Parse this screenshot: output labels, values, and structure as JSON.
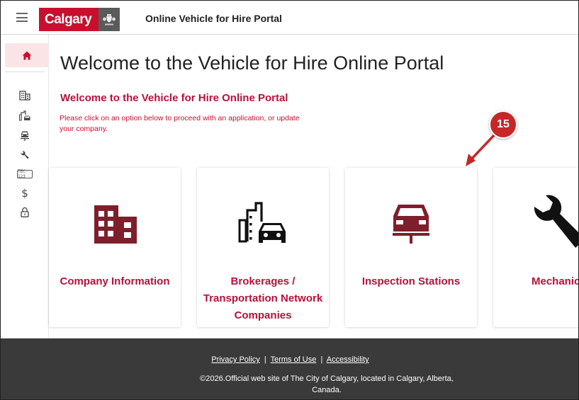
{
  "header": {
    "brand_text": "Calgary",
    "app_title": "Online Vehicle for Hire Portal"
  },
  "sidenav": {
    "items": [
      {
        "icon": "home-icon"
      },
      {
        "icon": "building-icon"
      },
      {
        "icon": "brokerage-car-icon"
      },
      {
        "icon": "inspection-car-icon"
      },
      {
        "icon": "wrench-icon"
      },
      {
        "icon": "license-plate-icon",
        "plate_text": "TEC-123"
      },
      {
        "icon": "dollar-icon",
        "glyph": "$"
      },
      {
        "icon": "lock-icon"
      }
    ]
  },
  "main": {
    "page_title": "Welcome to the Vehicle for Hire Online Portal",
    "section_title": "Welcome to the Vehicle for Hire Online Portal",
    "intro_line1": "Please click on an option below to proceed with an application, or update",
    "intro_line2": "your company.",
    "cards": [
      {
        "label": "Company Information"
      },
      {
        "label": "Brokerages / Transportation Network Companies"
      },
      {
        "label": "Inspection Stations"
      },
      {
        "label": "Mechanic"
      }
    ]
  },
  "callout": {
    "number": "15"
  },
  "footer": {
    "privacy": "Privacy Policy",
    "terms": "Terms of Use",
    "accessibility": "Accessibility",
    "separator": "|",
    "copyright_line1": "©2026.Official web site of The City of Calgary, located in Calgary, Alberta,",
    "copyright_line2": "Canada."
  },
  "colors": {
    "brand_red": "#c8102e",
    "dark_red": "#b5123a",
    "icon_maroon": "#7e1f2c",
    "footer_bg": "#3a3a3a",
    "callout": "#c62828"
  }
}
